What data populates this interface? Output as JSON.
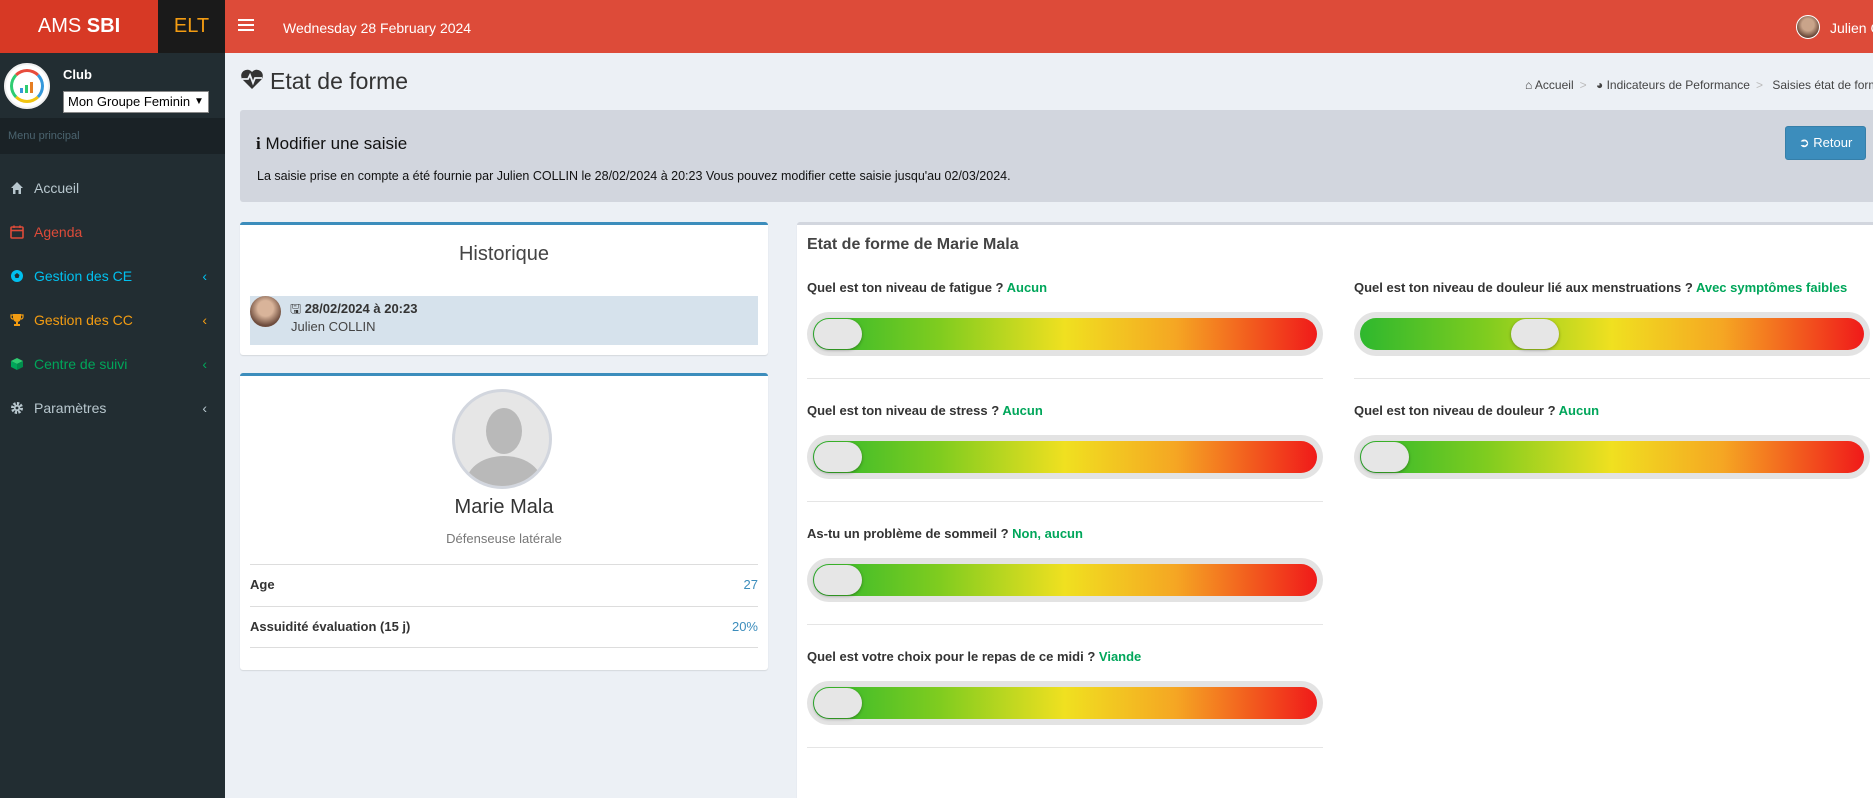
{
  "header": {
    "logo_thin": "AMS",
    "logo_bold": "SBI",
    "badge": "ELT",
    "date": "Wednesday 28 February 2024",
    "user_name": "Julien C"
  },
  "sidebar": {
    "club_label": "Club",
    "group_select": "Mon Groupe Feminin",
    "menu_header": "Menu principal",
    "items": [
      {
        "label": "Accueil",
        "icon": "home-icon",
        "color": "#b8c7ce",
        "chevron": ""
      },
      {
        "label": "Agenda",
        "icon": "calendar-icon",
        "color": "#dd4b39",
        "chevron": ""
      },
      {
        "label": "Gestion des CE",
        "icon": "soccer-ball-icon",
        "color": "#00c0ef",
        "chevron": "‹"
      },
      {
        "label": "Gestion des CC",
        "icon": "trophy-icon",
        "color": "#f39c12",
        "chevron": "‹"
      },
      {
        "label": "Centre de suivi",
        "icon": "cube-icon",
        "color": "#00a65a",
        "chevron": "‹"
      },
      {
        "label": "Paramètres",
        "icon": "gear-icon",
        "color": "#b8c7ce",
        "chevron": "‹"
      }
    ]
  },
  "page": {
    "title": "Etat de forme",
    "breadcrumb": [
      "Accueil",
      "Indicateurs de Peformance",
      "Saisies état de form"
    ]
  },
  "callout": {
    "title": "Modifier une saisie",
    "text": "La saisie prise en compte a été fournie par Julien COLLIN le 28/02/2024 à 20:23 Vous pouvez modifier cette saisie jusqu'au 02/03/2024.",
    "button": "Retour"
  },
  "historique": {
    "title": "Historique",
    "entries": [
      {
        "date": "28/02/2024 à 20:23",
        "user": "Julien COLLIN"
      }
    ]
  },
  "profile": {
    "name": "Marie Mala",
    "role": "Défenseuse latérale",
    "stats": [
      {
        "label": "Age",
        "value": "27"
      },
      {
        "label": "Assuidité évaluation (15 j)",
        "value": "20%"
      }
    ]
  },
  "form": {
    "title": "Etat de forme de Marie Mala",
    "questions": [
      {
        "label": "Quel est ton niveau de fatigue ?",
        "answer": "Aucun",
        "level": 0.0
      },
      {
        "label": "Quel est ton niveau de stress ?",
        "answer": "Aucun",
        "level": 0.0
      },
      {
        "label": "As-tu un problème de sommeil ?",
        "answer": "Non, aucun",
        "level": 0.0
      },
      {
        "label": "Quel est votre choix pour le repas de ce midi ?",
        "answer": "Viande",
        "level": 0.0
      },
      {
        "label": "Quel est ton niveau de douleur lié aux menstruations ?",
        "answer": "Avec symptômes faibles",
        "level": 0.33
      },
      {
        "label": "Quel est ton niveau de douleur ?",
        "answer": "Aucun",
        "level": 0.0
      }
    ]
  }
}
